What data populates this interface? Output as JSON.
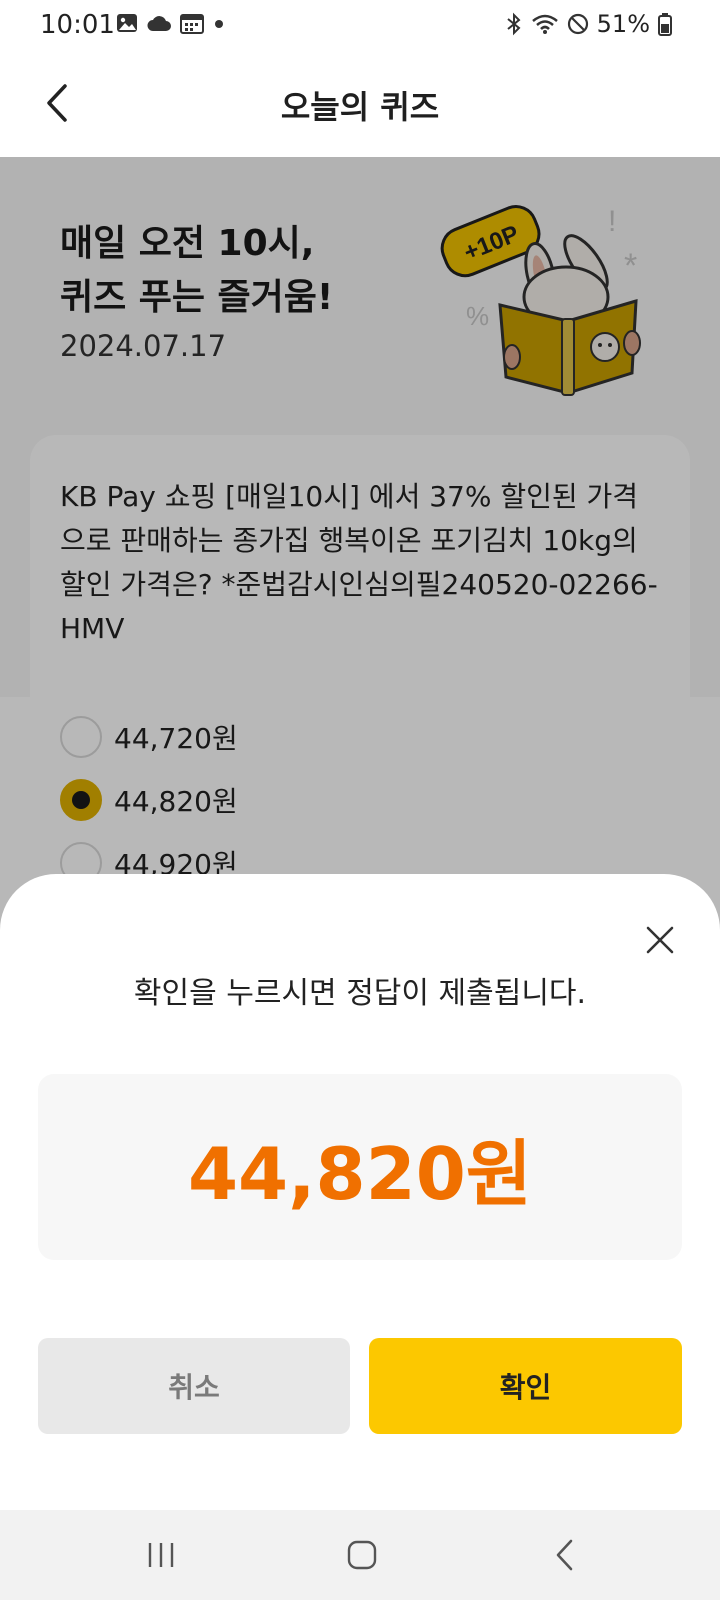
{
  "status_bar": {
    "time": "10:01",
    "battery": "51%",
    "left_icons": [
      "image-icon",
      "cloud-icon",
      "calendar-icon",
      "dot-icon"
    ],
    "right_icons": [
      "bluetooth-icon",
      "wifi-icon",
      "dnd-icon",
      "battery-icon"
    ]
  },
  "app_bar": {
    "title": "오늘의 퀴즈"
  },
  "hero": {
    "title_line1": "매일 오전 10시,",
    "title_line2": "퀴즈 푸는 즐거움!",
    "date": "2024.07.17",
    "badge": "+10P"
  },
  "question": {
    "text": "KB Pay 쇼핑 [매일10시] 에서 37% 할인된 가격으로 판매하는 종가집 행복이온 포기김치 10kg의 할인 가격은? *준법감시인심의필240520-02266-HMV",
    "options": [
      {
        "label": "44,720원",
        "selected": false
      },
      {
        "label": "44,820원",
        "selected": true
      },
      {
        "label": "44,920원",
        "selected": false
      }
    ]
  },
  "sheet": {
    "message": "확인을 누르시면 정답이 제출됩니다.",
    "answer": "44,820원",
    "cancel_label": "취소",
    "confirm_label": "확인"
  },
  "colors": {
    "accent_yellow": "#fcc800",
    "answer_orange": "#f07000",
    "selected_radio": "#e0b000"
  }
}
